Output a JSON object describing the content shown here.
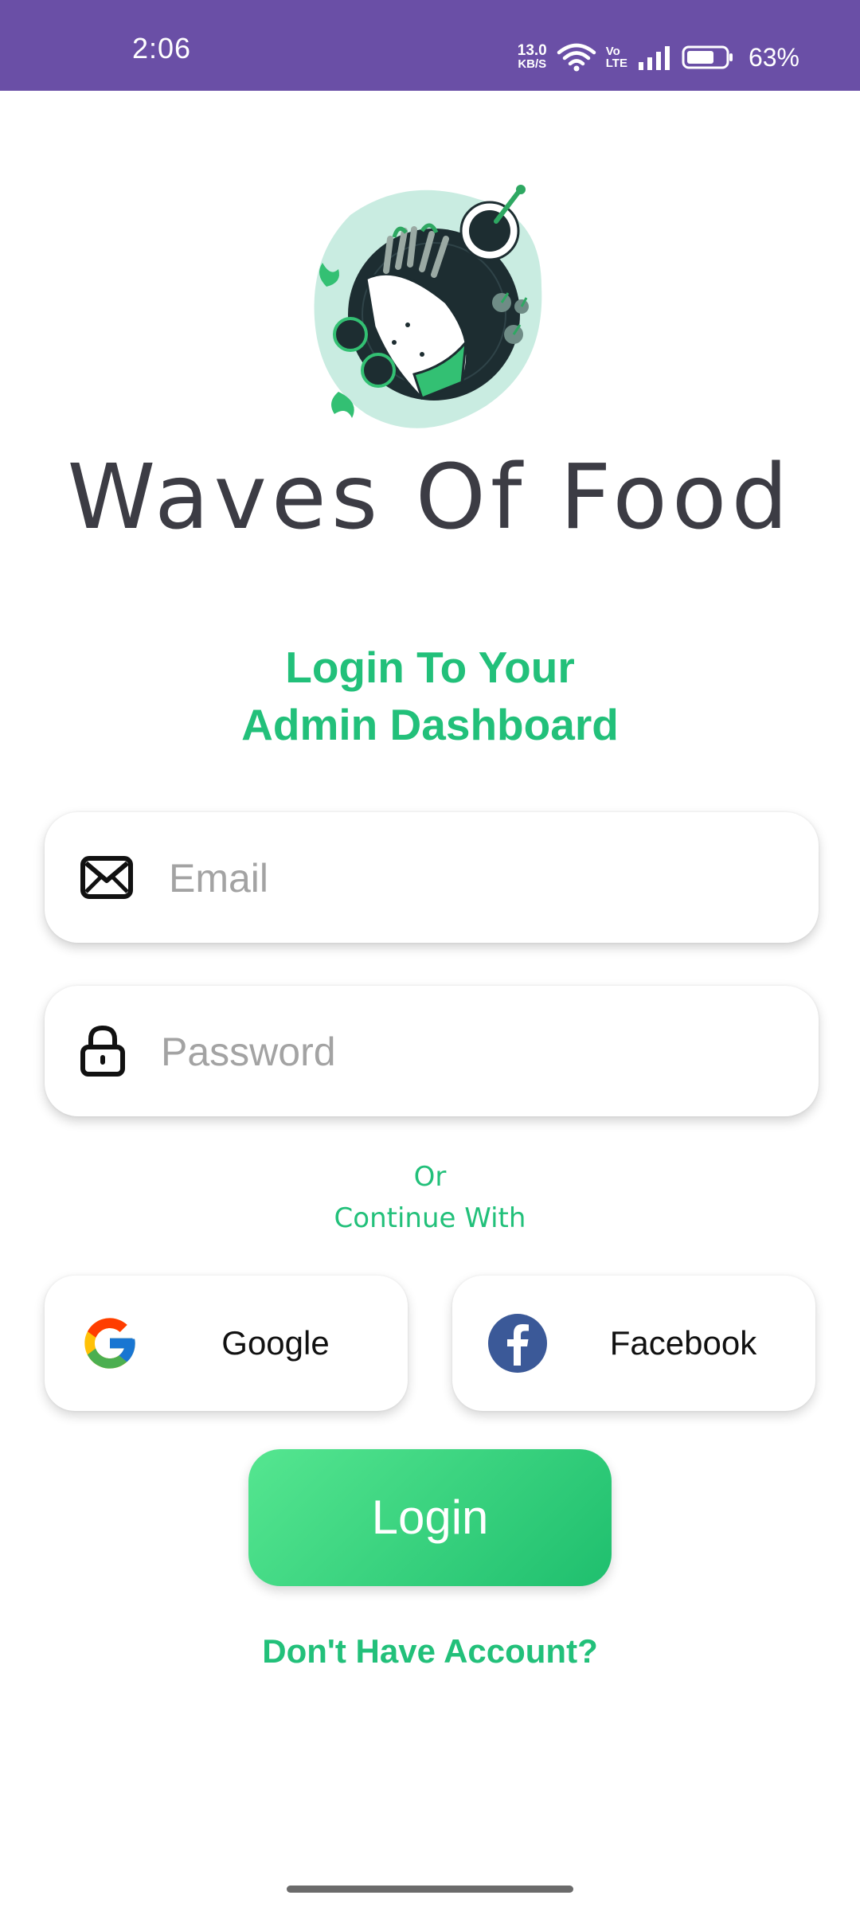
{
  "status_bar": {
    "time": "2:06",
    "net_speed_value": "13.0",
    "net_speed_unit": "KB/S",
    "volte_top": "Vo",
    "volte_bottom": "LTE",
    "battery_percent": "63%",
    "background_color": "#6a4fa6"
  },
  "header": {
    "app_title": "Waves Of Food",
    "headline_line1": "Login To Your",
    "headline_line2": "Admin Dashboard",
    "accent_color": "#22c07a"
  },
  "form": {
    "email": {
      "placeholder": "Email",
      "value": "",
      "icon": "envelope-icon"
    },
    "password": {
      "placeholder": "Password",
      "value": "",
      "icon": "lock-icon"
    }
  },
  "divider": {
    "or_label": "Or",
    "continue_label": "Continue With"
  },
  "social": {
    "google_label": "Google",
    "facebook_label": "Facebook"
  },
  "actions": {
    "login_label": "Login",
    "signup_link_label": "Don't Have Account?"
  }
}
